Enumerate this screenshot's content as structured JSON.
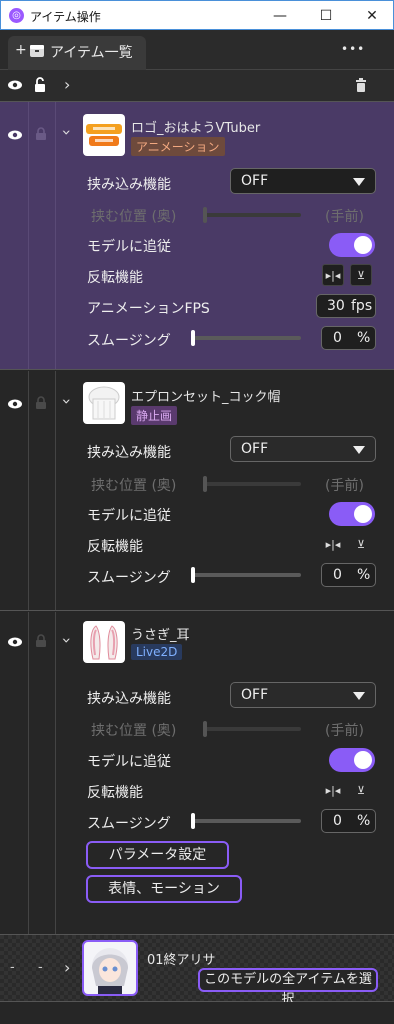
{
  "window": {
    "title": "アイテム操作",
    "app_icon": "アプリ",
    "min": "—",
    "max": "☐",
    "close": "✕"
  },
  "tab": {
    "plus": "+",
    "label": "アイテム一覧",
    "more": "•••"
  },
  "toolbar": {
    "chevron": "›"
  },
  "colors": {
    "accent": "#8a5cf6",
    "selected_bg": "#4a3a66",
    "badge_anim_bg": "#6e4a3c",
    "badge_anim_fg": "#f2a880",
    "badge_still_bg": "#5a3a6e",
    "badge_still_fg": "#d9a8f0",
    "badge_l2d_bg": "#283a5e",
    "badge_l2d_fg": "#7fb0ff"
  },
  "items": [
    {
      "name": "ロゴ_おはようVTuber",
      "badge": "アニメーション",
      "mask_label": "挟み込み機能",
      "mask_value": "OFF",
      "pos_label": "挟む位置 (奥)",
      "pos_right": "(手前)",
      "follow_label": "モデルに追従",
      "flip_label": "反転機能",
      "fps_label": "アニメーションFPS",
      "fps_value": "30",
      "fps_unit": "fps",
      "smooth_label": "スムージング",
      "smooth_value": "0",
      "smooth_unit": "%"
    },
    {
      "name": "エプロンセット_コック帽",
      "badge": "静止画",
      "mask_label": "挟み込み機能",
      "mask_value": "OFF",
      "pos_label": "挟む位置 (奥)",
      "pos_right": "(手前)",
      "follow_label": "モデルに追従",
      "flip_label": "反転機能",
      "smooth_label": "スムージング",
      "smooth_value": "0",
      "smooth_unit": "%"
    },
    {
      "name": "うさぎ_耳",
      "badge": "Live2D",
      "mask_label": "挟み込み機能",
      "mask_value": "OFF",
      "pos_label": "挟む位置 (奥)",
      "pos_right": "(手前)",
      "follow_label": "モデルに追従",
      "flip_label": "反転機能",
      "smooth_label": "スムージング",
      "smooth_value": "0",
      "smooth_unit": "%",
      "param_button": "パラメータ設定",
      "expr_button": "表情、モーション"
    }
  ],
  "model": {
    "name": "01終アリサ",
    "dash1": "-",
    "dash2": "-",
    "select_all": "このモデルの全アイテムを選択"
  }
}
